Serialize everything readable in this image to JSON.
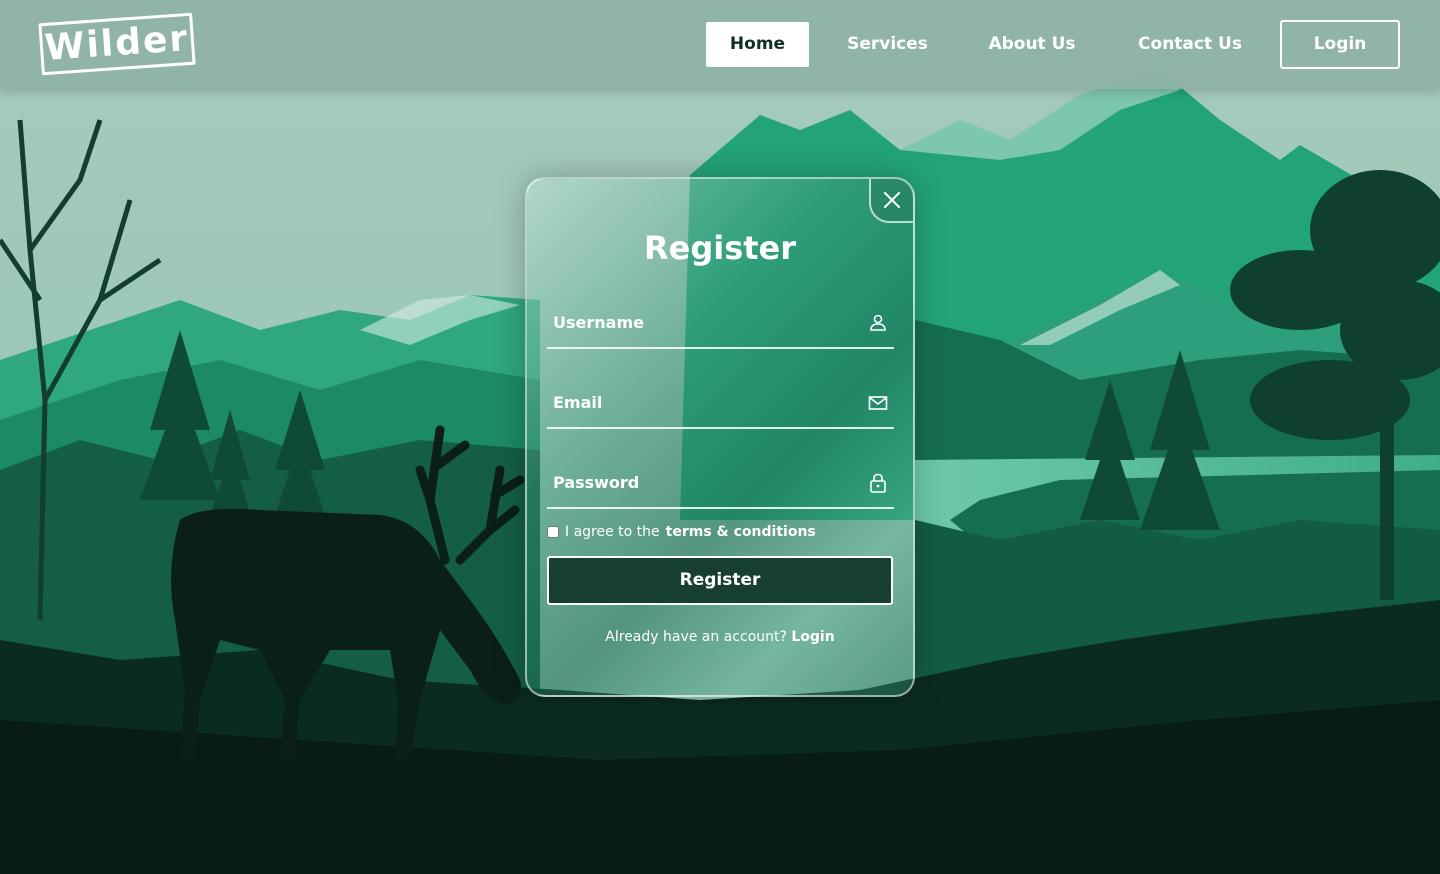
{
  "header": {
    "logo_text": "Wilder",
    "nav": [
      {
        "label": "Home",
        "active": true
      },
      {
        "label": "Services"
      },
      {
        "label": "About Us"
      },
      {
        "label": "Contact Us"
      },
      {
        "label": "Login"
      }
    ]
  },
  "modal": {
    "title": "Register",
    "close_icon": "close-icon",
    "fields": {
      "username": {
        "label": "Username",
        "icon": "user-icon"
      },
      "email": {
        "label": "Email",
        "icon": "mail-icon"
      },
      "password": {
        "label": "Password",
        "icon": "lock-icon"
      }
    },
    "agree": {
      "prefix": "I agree to the",
      "link": "terms & conditions",
      "checked": false
    },
    "register_button": "Register",
    "footer": {
      "text": "Already have an account?",
      "link": "Login"
    }
  },
  "colors": {
    "accent": "#173f31",
    "sky": "#9cc6b8",
    "mountain": "#1f9a72",
    "forest": "#0e3a2c",
    "ground": "#061c14"
  }
}
